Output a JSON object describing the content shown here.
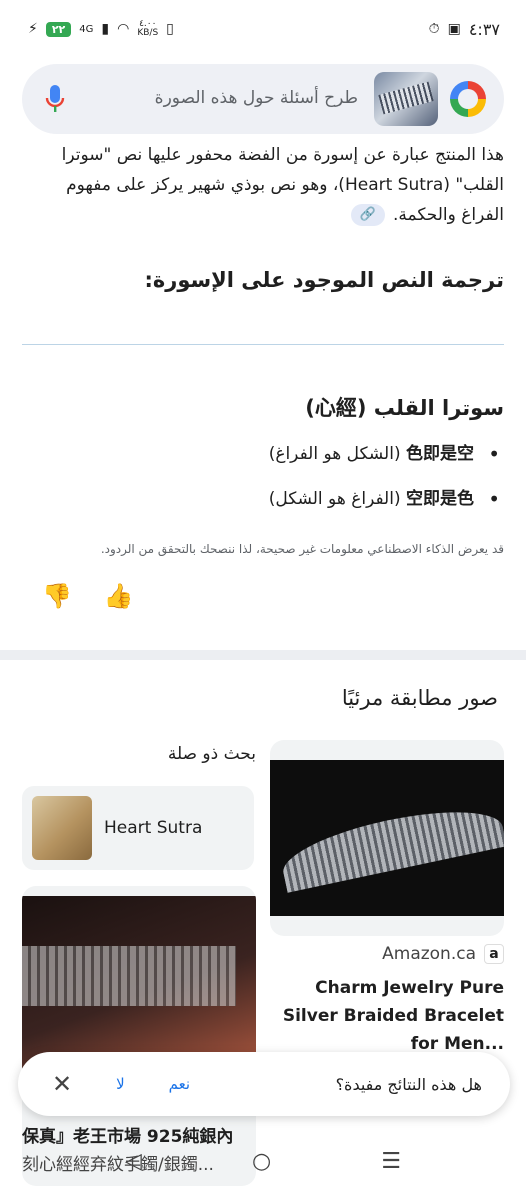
{
  "status": {
    "time": "٤:٣٧",
    "battery": "٢٢",
    "network_speed_value": "٤.٠٠",
    "network_speed_unit": "KB/S",
    "network_type": "4G"
  },
  "search": {
    "placeholder": "طرح أسئلة حول هذه الصورة"
  },
  "answer": {
    "text": "هذا المنتج عبارة عن إسورة من الفضة محفور عليها نص \"سوترا القلب\" (Heart Sutra)، وهو نص بوذي شهير يركز على مفهوم الفراغ والحكمة.",
    "heading": "ترجمة النص الموجود على الإسورة:",
    "subheading": "سوترا القلب (心經)",
    "bullets": [
      {
        "bold": "色即是空",
        "rest": "(الشكل هو الفراغ)"
      },
      {
        "bold": "空即是色",
        "rest": "(الفراغ هو الشكل)"
      }
    ],
    "disclaimer": "قد يعرض الذكاء الاصطناعي معلومات غير صحيحة، لذا ننصحك بالتحقق من الردود."
  },
  "visual_matches": {
    "title": "صور مطابقة مرئيًا",
    "related_title": "بحث ذو صلة",
    "related_item": "Heart Sutra",
    "right_card": {
      "source": "Amazon.ca",
      "title": "Charm Jewelry Pure Silver Braided Bracelet for Men..."
    },
    "left_card": {
      "title": "保真』老王市場 925純銀內",
      "subtitle": "刻心經經弃紋手鐲/銀鐲..."
    }
  },
  "feedback_bar": {
    "question": "هل هذه النتائج مفيدة؟",
    "yes": "نعم",
    "no": "لا"
  },
  "icons": {
    "mic": "mic-icon",
    "google": "google-logo-icon",
    "link": "link-icon",
    "thumbs_up": "thumbs-up-icon",
    "thumbs_down": "thumbs-down-icon",
    "close": "close-icon",
    "nav_menu": "menu-icon",
    "nav_home": "home-icon",
    "nav_back": "back-icon",
    "amazon": "amazon-logo-icon"
  }
}
